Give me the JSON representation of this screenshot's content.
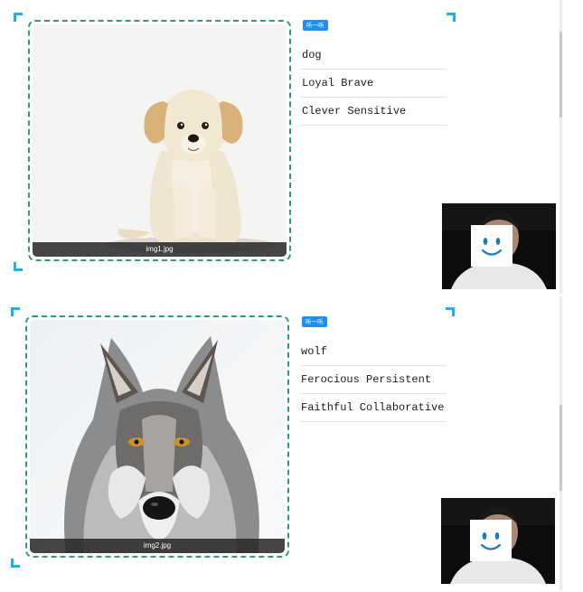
{
  "listen_label": "听一听",
  "cards": [
    {
      "caption": "img1.jpg",
      "words": [
        "dog",
        "Loyal Brave",
        "Clever Sensitive"
      ],
      "image_icon": "puppy-photo"
    },
    {
      "caption": "img2.jpg",
      "words": [
        "wolf",
        "Ferocious Persistent",
        "Faithful Collaborative"
      ],
      "image_icon": "wolf-photo"
    }
  ],
  "colors": {
    "accent_corner": "#19b0f0",
    "dashed_frame": "#2a9a80",
    "listen_button": "#1e90f0"
  },
  "icons": {
    "camera_overlay": "smiley-face-icon"
  }
}
